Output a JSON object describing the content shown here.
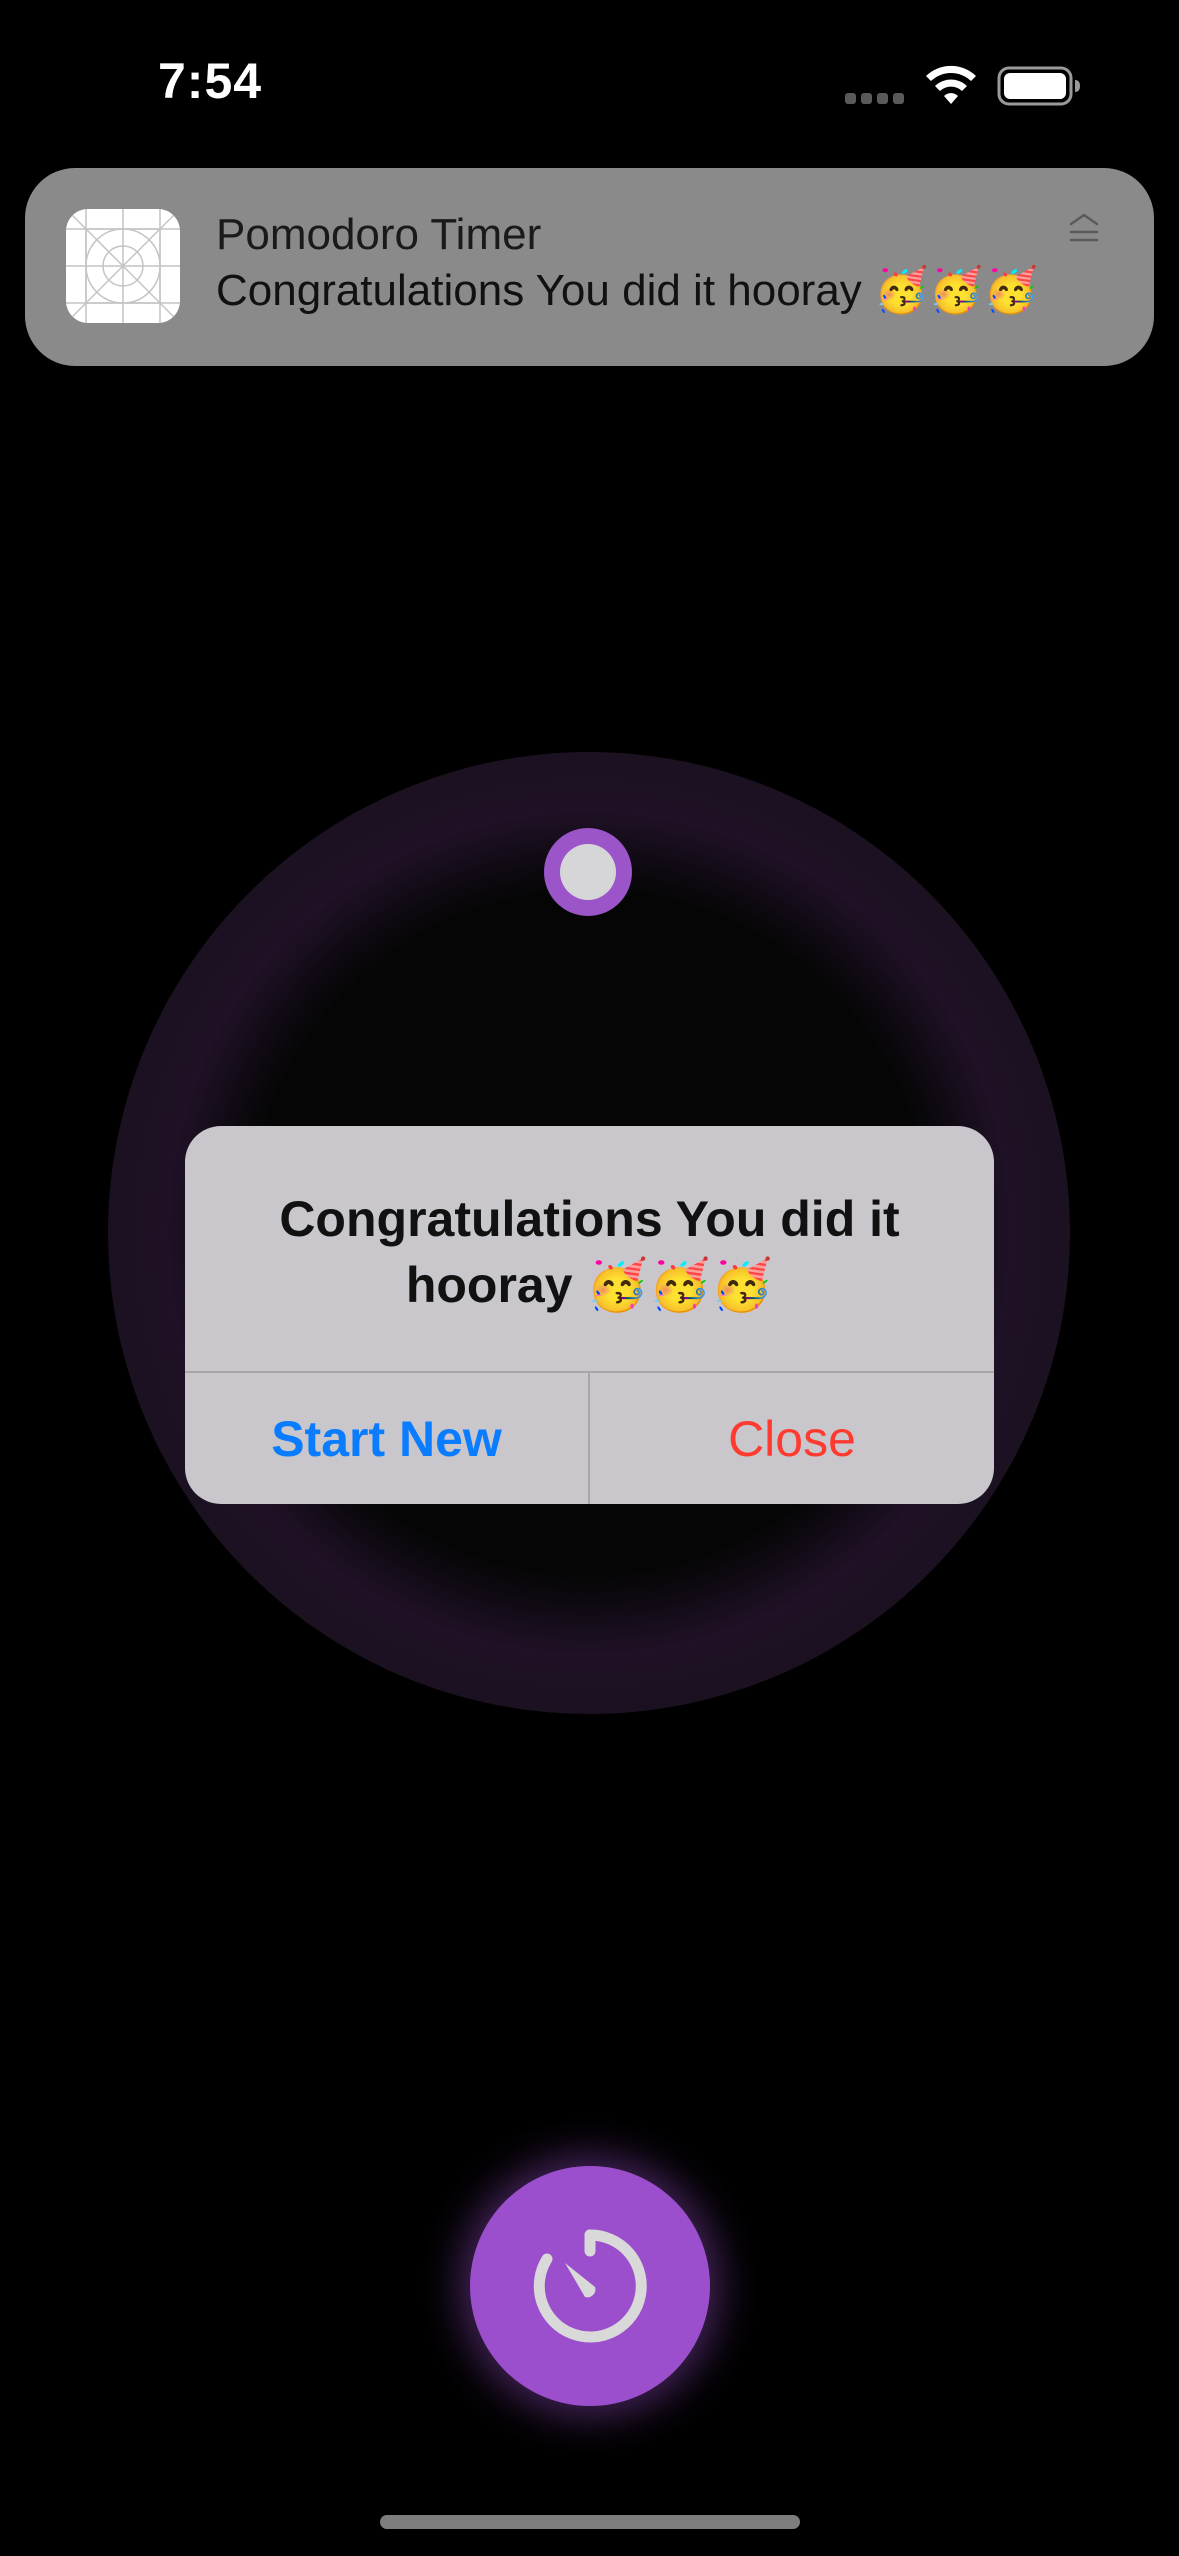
{
  "status_bar": {
    "time": "7:54",
    "icons": [
      "cellular-signal-icon",
      "wifi-icon",
      "battery-icon"
    ]
  },
  "notification": {
    "app_name": "Pomodoro Timer",
    "message": "Congratulations You did it hooray 🥳🥳🥳",
    "app_icon": "app-placeholder-icon",
    "expand_icon": "expand-icon"
  },
  "timer": {
    "accent_color": "#9b4fcc"
  },
  "alert": {
    "title": "Congratulations You did it hooray 🥳🥳🥳",
    "primary_button": "Start New",
    "secondary_button": "Close",
    "primary_color": "#0a7cff",
    "destructive_color": "#ff3b30"
  },
  "bottom_button": {
    "icon": "timer-icon"
  }
}
